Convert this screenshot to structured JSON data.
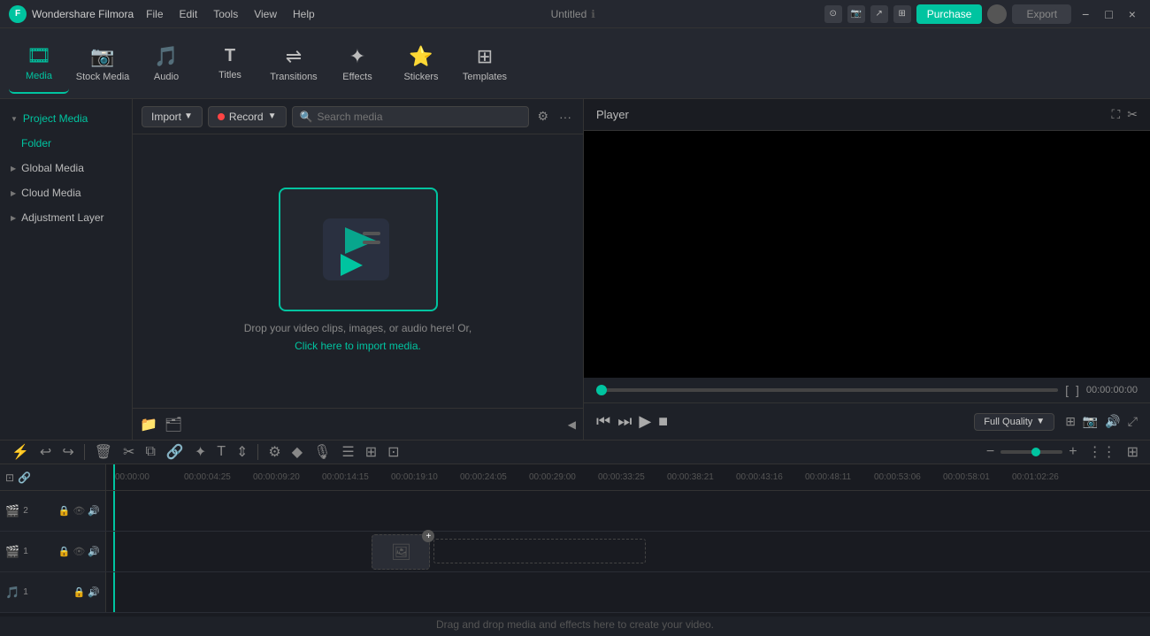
{
  "app": {
    "name": "Wondershare Filmora",
    "title": "Untitled",
    "logo_text": "F"
  },
  "menus": [
    "File",
    "Edit",
    "Tools",
    "View",
    "Help"
  ],
  "toolbar": {
    "items": [
      {
        "id": "media",
        "label": "Media",
        "icon": "🎞",
        "active": true
      },
      {
        "id": "stock",
        "label": "Stock Media",
        "icon": "📷",
        "active": false
      },
      {
        "id": "audio",
        "label": "Audio",
        "icon": "🎵",
        "active": false
      },
      {
        "id": "titles",
        "label": "Titles",
        "icon": "T",
        "active": false
      },
      {
        "id": "transitions",
        "label": "Transitions",
        "icon": "⇌",
        "active": false
      },
      {
        "id": "effects",
        "label": "Effects",
        "icon": "✦",
        "active": false
      },
      {
        "id": "stickers",
        "label": "Stickers",
        "icon": "⭐",
        "active": false
      },
      {
        "id": "templates",
        "label": "Templates",
        "icon": "⊞",
        "active": false
      }
    ]
  },
  "left_panel": {
    "items": [
      {
        "id": "project-media",
        "label": "Project Media",
        "active": true
      },
      {
        "id": "folder",
        "label": "Folder",
        "is_folder": true
      },
      {
        "id": "global-media",
        "label": "Global Media"
      },
      {
        "id": "cloud-media",
        "label": "Cloud Media"
      },
      {
        "id": "adjustment-layer",
        "label": "Adjustment Layer"
      }
    ]
  },
  "media_panel": {
    "import_label": "Import",
    "record_label": "Record",
    "search_placeholder": "Search media",
    "drop_text": "Drop your video clips, images, or audio here! Or,",
    "drop_link": "Click here to import media."
  },
  "player": {
    "title": "Player",
    "time": "00:00:00:00",
    "quality_label": "Full Quality"
  },
  "timeline": {
    "drag_drop_label": "Drag and drop media and effects here to create your video.",
    "ruler_marks": [
      "00:00:00",
      "00:00:04:25",
      "00:00:09:20",
      "00:00:14:15",
      "00:00:19:10",
      "00:00:24:05",
      "00:00:29:00",
      "00:00:33:25",
      "00:00:38:21",
      "00:00:43:16",
      "00:00:48:11",
      "00:00:53:06",
      "00:00:58:01",
      "00:01:02:26"
    ],
    "tracks": [
      {
        "id": "video2",
        "icon": "🎬",
        "num": "2",
        "type": "video"
      },
      {
        "id": "video1",
        "icon": "🎬",
        "num": "1",
        "type": "video",
        "has_placeholder": true
      },
      {
        "id": "audio1",
        "icon": "🎵",
        "num": "1",
        "type": "audio"
      }
    ]
  },
  "title_bar_icons": {
    "record": "⊙",
    "restore": "⊡",
    "help": "?",
    "purchase": "Purchase",
    "export": "Export",
    "minimize": "−",
    "maximize": "□",
    "close": "×"
  }
}
